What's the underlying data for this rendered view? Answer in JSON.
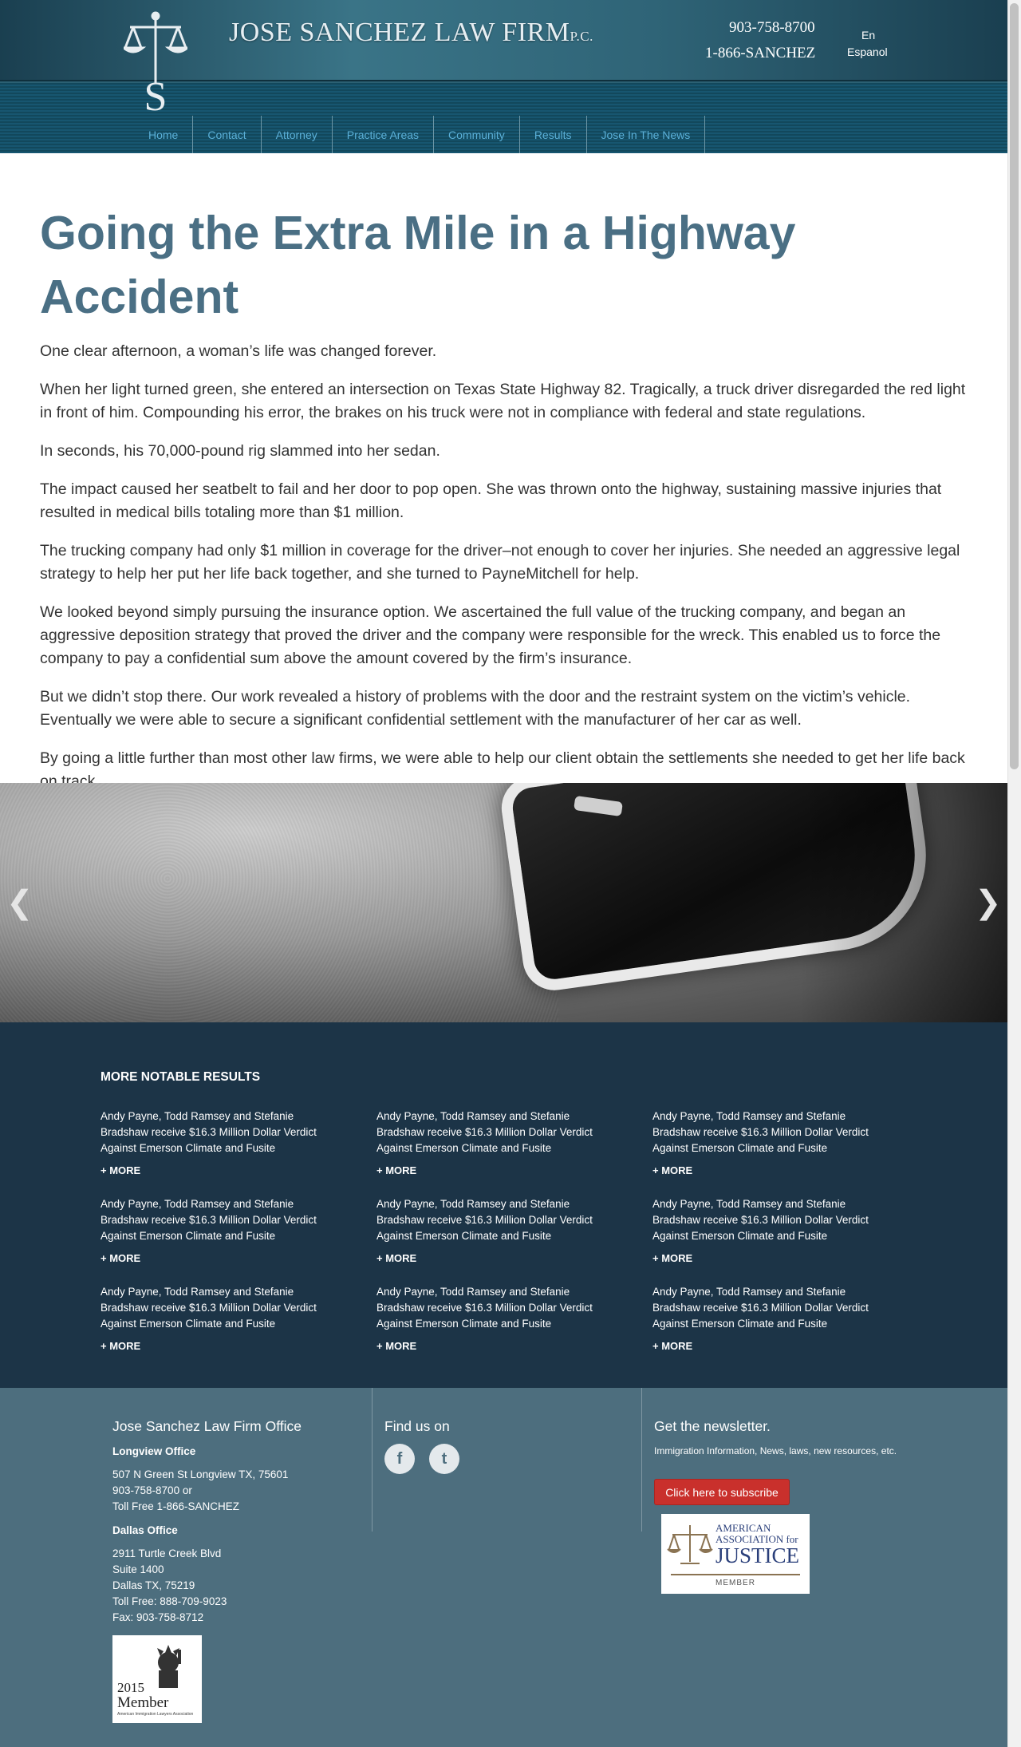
{
  "header": {
    "firm_name": "JOSE SANCHEZ LAW FIRM",
    "firm_suffix": "P.C.",
    "phone_local": "903-758-8700",
    "phone_toll": "1-866-SANCHEZ",
    "lang_en": "En",
    "lang_es": "Espanol"
  },
  "nav": {
    "items": [
      {
        "label": "Home"
      },
      {
        "label": "Contact"
      },
      {
        "label": "Attorney"
      },
      {
        "label": "Practice Areas"
      },
      {
        "label": "Community"
      },
      {
        "label": "Results"
      },
      {
        "label": "Jose In The News"
      }
    ]
  },
  "article": {
    "title": "Going the Extra Mile in a Highway Accident",
    "paragraphs": [
      "One clear afternoon, a woman’s life was changed forever.",
      "When her light turned green, she entered an intersection on Texas State Highway 82. Tragically, a truck driver disregarded the red light in front of him. Compounding his error, the brakes on his truck were not in compliance with federal and state regulations.",
      "In seconds, his 70,000-pound rig slammed into her sedan.",
      "The impact caused her seatbelt to fail and her door to pop open. She was thrown onto the highway, sustaining massive injuries that resulted in medical bills totaling more than $1 million.",
      "The trucking company had only $1 million in coverage for the driver–not enough to cover her injuries. She needed an aggressive legal strategy to help her put her life back together, and she turned to PayneMitchell for help.",
      "We looked beyond simply pursuing the insurance option. We ascertained the full value of the trucking company, and began an aggressive deposition strategy that proved the driver and the company were responsible for the wreck. This enabled us to force the company to pay a confidential sum above the amount covered by the firm’s insurance.",
      "But we didn’t stop there. Our work revealed a history of problems with the door and the restraint system on the victim’s vehicle. Eventually we were able to secure a significant confidential settlement with the manufacturer of her car as well.",
      "By going a little further than most other law firms, we were able to help our client obtain the settlements she needed to get her life back on track."
    ]
  },
  "results": {
    "heading": "MORE NOTABLE RESULTS",
    "items": [
      {
        "text": "Andy Payne, Todd Ramsey and Stefanie Bradshaw receive $16.3 Million Dollar Verdict Against Emerson Climate and Fusite",
        "more": "+ MORE"
      },
      {
        "text": "Andy Payne, Todd Ramsey and Stefanie Bradshaw receive $16.3 Million Dollar Verdict Against Emerson Climate and Fusite",
        "more": "+ MORE"
      },
      {
        "text": "Andy Payne, Todd Ramsey and Stefanie Bradshaw receive $16.3 Million Dollar Verdict Against Emerson Climate and Fusite",
        "more": "+ MORE"
      },
      {
        "text": "Andy Payne, Todd Ramsey and Stefanie Bradshaw receive $16.3 Million Dollar Verdict Against Emerson Climate and Fusite",
        "more": "+ MORE"
      },
      {
        "text": "Andy Payne, Todd Ramsey and Stefanie Bradshaw receive $16.3 Million Dollar Verdict Against Emerson Climate and Fusite",
        "more": "+ MORE"
      },
      {
        "text": "Andy Payne, Todd Ramsey and Stefanie Bradshaw receive $16.3 Million Dollar Verdict Against Emerson Climate and Fusite",
        "more": "+ MORE"
      },
      {
        "text": "Andy Payne, Todd Ramsey and Stefanie Bradshaw receive $16.3 Million Dollar Verdict Against Emerson Climate and Fusite",
        "more": "+ MORE"
      },
      {
        "text": "Andy Payne, Todd Ramsey and Stefanie Bradshaw receive $16.3 Million Dollar Verdict Against Emerson Climate and Fusite",
        "more": "+ MORE"
      },
      {
        "text": "Andy Payne, Todd Ramsey and Stefanie Bradshaw receive $16.3 Million Dollar Verdict Against Emerson Climate and Fusite",
        "more": "+ MORE"
      }
    ]
  },
  "footer": {
    "office_title": "Jose Sanchez Law Firm Office",
    "longview": {
      "label": "Longview Office",
      "address": "507 N Green St Longview TX, 75601",
      "phone": "903-758-8700 or",
      "toll": "Toll Free 1-866-SANCHEZ"
    },
    "dallas": {
      "label": "Dallas Office",
      "street": "2911 Turtle Creek Blvd",
      "suite": "Suite 1400",
      "city": "Dallas TX, 75219",
      "toll": "Toll Free: 888-709-9023",
      "fax": "Fax: 903-758-8712"
    },
    "member_badge": {
      "year": "2015",
      "label": "Member",
      "org": "American Immigration Lawyers Association"
    },
    "find_us": "Find us on",
    "social": [
      {
        "icon": "facebook-icon",
        "glyph": "f"
      },
      {
        "icon": "twitter-icon",
        "glyph": "t"
      }
    ],
    "newsletter_title": "Get the newsletter.",
    "newsletter_desc": "Immigration Information, News, laws, new resources, etc.",
    "subscribe_label": "Click here to subscribe",
    "aaj_badge": {
      "line1": "AMERICAN",
      "line2": "ASSOCIATION for",
      "line3": "JUSTICE",
      "line4": "MEMBER"
    }
  },
  "colors": {
    "title": "#4a6f84",
    "nav_link": "#5bb0d8",
    "results_bg": "#1c3447",
    "footer_bg": "#4d6e7e",
    "subscribe_bg": "#c9302c"
  }
}
